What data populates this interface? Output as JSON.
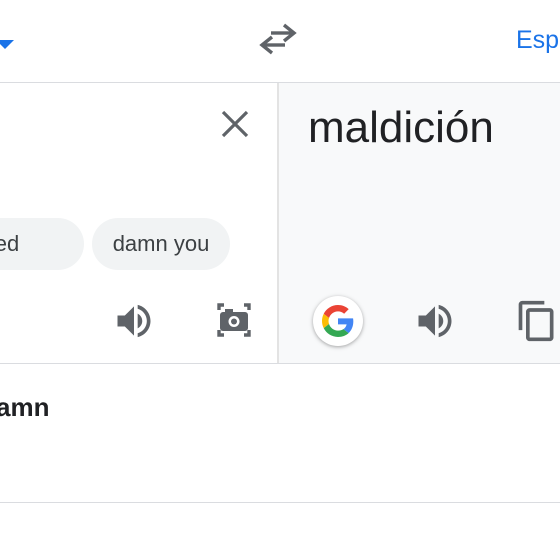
{
  "language_bar": {
    "source_dropdown_icon": "arrow-drop-down-icon",
    "swap_icon": "swap-horiz-icon",
    "target_language": "Esp"
  },
  "source_panel": {
    "clear_icon": "close-icon",
    "suggestions": [
      "amned",
      "damn you"
    ],
    "listen_icon": "volume-up-icon",
    "camera_icon": "camera-translate-icon"
  },
  "target_panel": {
    "translation": "maldición",
    "google_icon": "google-g-icon",
    "listen_icon": "volume-up-icon",
    "copy_icon": "copy-icon"
  },
  "definition": {
    "word": "amn"
  },
  "colors": {
    "accent": "#1a73e8",
    "icon_gray": "#5f6368",
    "text": "#202124",
    "chip_bg": "#f1f3f4",
    "target_bg": "#f8f9fa",
    "divider": "#dadce0"
  }
}
